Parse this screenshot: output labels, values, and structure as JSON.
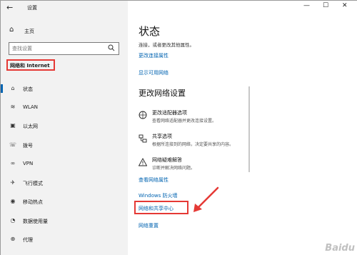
{
  "window": {
    "title": "设置"
  },
  "sidebar": {
    "home_label": "主页",
    "search_placeholder": "查找设置",
    "section_title": "网络和 Internet",
    "items": [
      {
        "label": "状态",
        "icon": "home-status-icon",
        "active": true
      },
      {
        "label": "WLAN",
        "icon": "wifi-icon"
      },
      {
        "label": "以太网",
        "icon": "ethernet-icon"
      },
      {
        "label": "拨号",
        "icon": "dialup-icon"
      },
      {
        "label": "VPN",
        "icon": "vpn-icon"
      },
      {
        "label": "飞行模式",
        "icon": "airplane-icon"
      },
      {
        "label": "移动热点",
        "icon": "hotspot-icon"
      },
      {
        "label": "数据使用量",
        "icon": "data-usage-icon"
      },
      {
        "label": "代理",
        "icon": "proxy-icon"
      }
    ]
  },
  "main": {
    "title": "状态",
    "status_description": "连接，或者更改其他属性。",
    "change_connection_properties": "更改连接属性",
    "show_available_networks": "显示可用网络",
    "change_network_settings_heading": "更改网络设置",
    "options": [
      {
        "title": "更改适配器选项",
        "description": "查看网络适配器并更改连接设置。",
        "icon": "adapter-icon"
      },
      {
        "title": "共享选项",
        "description": "根据所连接到的网络，决定要共享的内容。",
        "icon": "sharing-icon"
      },
      {
        "title": "网络疑难解答",
        "description": "诊断并解决网络问题。",
        "icon": "warning-icon"
      }
    ],
    "links": {
      "view_network_properties": "查看网络属性",
      "windows_firewall": "Windows 防火墙",
      "network_sharing_center": "网络和共享中心",
      "network_reset": "网络重置"
    }
  },
  "watermark": "Baidu",
  "colors": {
    "accent": "#0063b1",
    "highlight": "#e53935"
  }
}
